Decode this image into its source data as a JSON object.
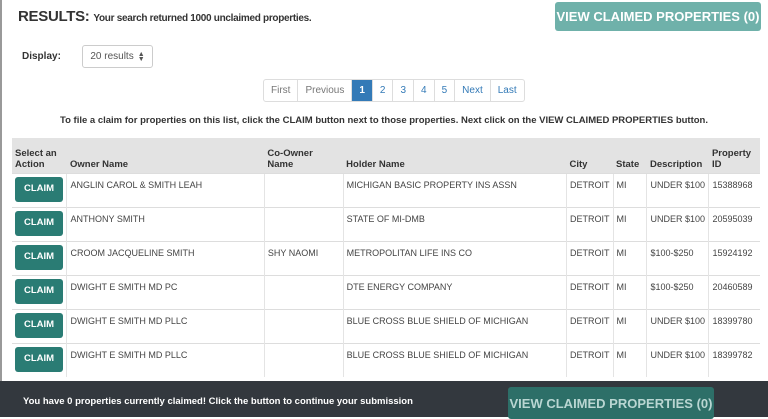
{
  "header": {
    "title": "RESULTS:",
    "subtitle": "Your search returned 1000 unclaimed properties.",
    "view_claimed_label": "VIEW CLAIMED PROPERTIES (0)"
  },
  "display": {
    "label": "Display:",
    "value": "20 results"
  },
  "pagination": {
    "items": [
      "First",
      "Previous",
      "1",
      "2",
      "3",
      "4",
      "5",
      "Next",
      "Last"
    ],
    "active": "1"
  },
  "instructions": "To file a claim for properties on this list, click the CLAIM button next to those properties. Next click on the VIEW CLAIMED PROPERTIES button.",
  "table": {
    "headers": [
      "Select an Action",
      "Owner Name",
      "Co-Owner Name",
      "Holder Name",
      "City",
      "State",
      "Description",
      "Property ID"
    ],
    "claim_label": "CLAIM",
    "rows": [
      [
        "ANGLIN CAROL & SMITH LEAH",
        "",
        "MICHIGAN BASIC PROPERTY INS ASSN",
        "DETROIT",
        "MI",
        "UNDER $100",
        "15388968"
      ],
      [
        "ANTHONY SMITH",
        "",
        "STATE OF MI-DMB",
        "DETROIT",
        "MI",
        "UNDER $100",
        "20595039"
      ],
      [
        "CROOM JACQUELINE SMITH",
        "SHY NAOMI",
        "METROPOLITAN LIFE INS CO",
        "DETROIT",
        "MI",
        "$100-$250",
        "15924192"
      ],
      [
        "DWIGHT E SMITH MD PC",
        "",
        "DTE ENERGY COMPANY",
        "DETROIT",
        "MI",
        "$100-$250",
        "20460589"
      ],
      [
        "DWIGHT E SMITH MD PLLC",
        "",
        "BLUE CROSS BLUE SHIELD OF MICHIGAN",
        "DETROIT",
        "MI",
        "UNDER $100",
        "18399780"
      ],
      [
        "DWIGHT E SMITH MD PLLC",
        "",
        "BLUE CROSS BLUE SHIELD OF MICHIGAN",
        "DETROIT",
        "MI",
        "UNDER $100",
        "18399782"
      ]
    ]
  },
  "footer": {
    "text": "You have 0 properties currently claimed! Click the button to continue your submission",
    "button_label": "VIEW CLAIMED PROPERTIES (0)"
  },
  "colors": {
    "primary": "#2a7c74",
    "pager_active": "#337ab7",
    "footer_bg": "#33383e"
  }
}
